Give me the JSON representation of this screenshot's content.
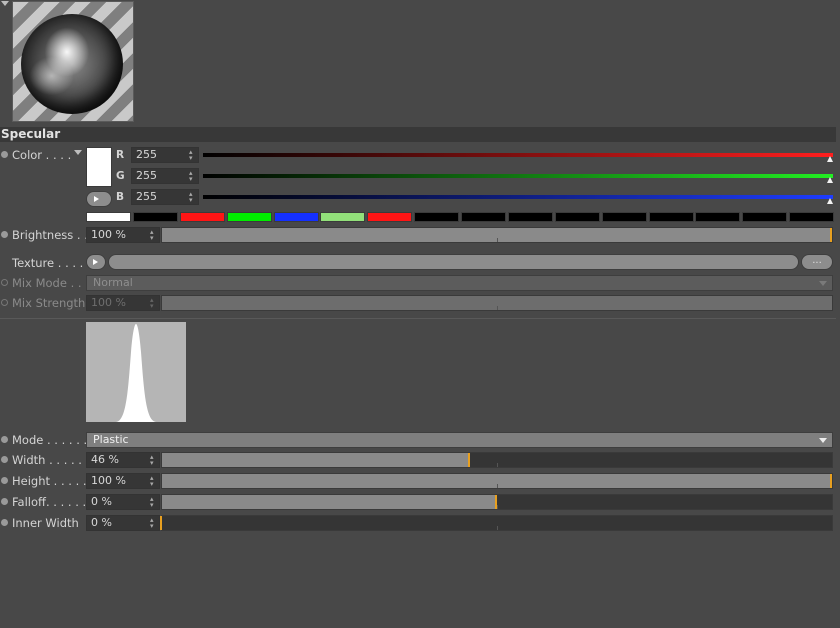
{
  "section": {
    "title": "Specular"
  },
  "color": {
    "label": "Color . . . .",
    "swatch_color": "#ffffff",
    "channels": [
      {
        "name": "R",
        "value": "255",
        "line_color": "#ff1e1e"
      },
      {
        "name": "G",
        "value": "255",
        "line_color": "#22ee22"
      },
      {
        "name": "B",
        "value": "255",
        "line_color": "#1e3cff"
      }
    ],
    "presets": [
      "#ffffff",
      "#000000",
      "#ff1515",
      "#00ee00",
      "#1530ff",
      "#92e07a",
      "#ff1515",
      "#000000",
      "#000000",
      "#000000",
      "#000000",
      "#000000",
      "#000000",
      "#000000",
      "#000000",
      "#000000"
    ]
  },
  "brightness": {
    "label": "Brightness . .",
    "value": "100 %",
    "level": 1.0
  },
  "texture": {
    "label": "Texture . . . .",
    "browse_label": "..."
  },
  "mix_mode": {
    "label": "Mix Mode . .",
    "value": "Normal"
  },
  "mix_strength": {
    "label": "Mix Strength",
    "value": "100 %",
    "level": 1.0
  },
  "mode": {
    "label": "Mode . . . . . .",
    "value": "Plastic"
  },
  "width": {
    "label": "Width . . . . . .",
    "value": "46 %",
    "level": 0.46
  },
  "height": {
    "label": "Height . . . . .",
    "value": "100 %",
    "level": 1.0
  },
  "falloff": {
    "label": "Falloff. . . . . .",
    "value": "0 %",
    "level": 0.5
  },
  "inner_width": {
    "label": "Inner Width",
    "value": "0 %",
    "level": 0.0
  }
}
